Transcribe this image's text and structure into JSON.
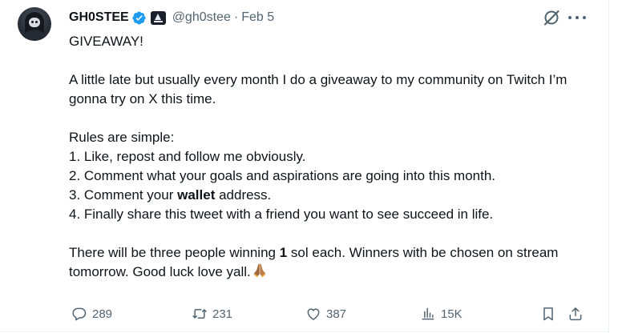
{
  "author": {
    "display_name": "GH0STEE",
    "handle": "@gh0stee",
    "separator": "·",
    "date": "Feb 5",
    "verified_color": "#1d9bf0"
  },
  "tweet": {
    "title": "GIVEAWAY!",
    "intro": "A little late but usually every month I do a giveaway to my community on Twitch I’m gonna try on X this time.",
    "rules_heading": "Rules are simple:",
    "rule1": "1. Like, repost and follow me obviously.",
    "rule2": "2. Comment what your goals and aspirations are going into this month.",
    "rule3_prefix": "3. Comment your ",
    "rule3_bold": "wallet",
    "rule3_suffix": " address.",
    "rule4": "4. Finally share this tweet with a friend you want to see succeed in life.",
    "closing_prefix": "There will be three people winning ",
    "closing_bold": "1",
    "closing_suffix": " sol each. Winners with be chosen on stream tomorrow. Good luck love yall.",
    "emoji": "folded-hands-emoji"
  },
  "actions": {
    "replies": "289",
    "reposts": "231",
    "likes": "387",
    "views": "15K"
  },
  "icons": [
    "grok-icon",
    "more-icon",
    "reply-icon",
    "repost-icon",
    "like-icon",
    "views-icon",
    "bookmark-icon",
    "share-icon"
  ],
  "colors": {
    "text": "#0f1419",
    "secondary": "#536471",
    "verified": "#1d9bf0",
    "divider": "#eff3f4"
  }
}
